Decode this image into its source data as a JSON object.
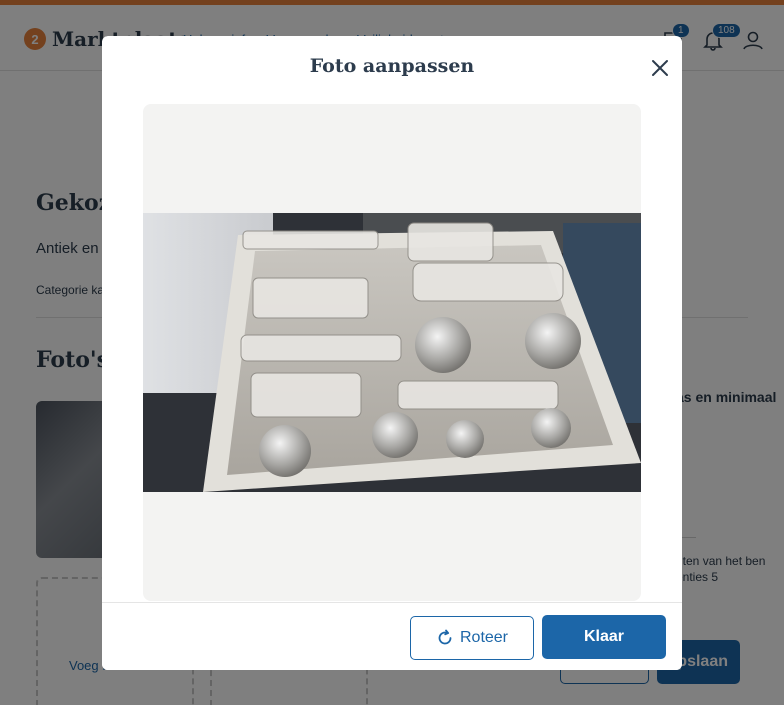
{
  "header": {
    "logo_text": "Marktplaats",
    "nav_links": [
      "Help en info",
      "Voorwaarden",
      "Veiligheidscentrum"
    ],
    "messages_badge": "1",
    "notifications_badge": "108"
  },
  "background": {
    "title": "Gekoze",
    "category": "Antiek en",
    "category_link": "Categorie ka",
    "photos_heading": "Foto's",
    "add_photo_text": "Voeg foto's toe",
    "tip_text": "as en minimaal",
    "note_text": "nten van het ben enties 5",
    "save_button": "Opslaan"
  },
  "modal": {
    "title": "Foto aanpassen",
    "rotate_button": "Roteer",
    "done_button": "Klaar"
  },
  "colors": {
    "accent": "#1c66a8",
    "brand": "#e8823c",
    "canvas_bg": "#f3f3f2"
  },
  "icons": {
    "close": "close-icon",
    "rotate": "rotate-icon",
    "messages": "chat-icon",
    "notifications": "bell-icon",
    "profile": "user-icon"
  }
}
